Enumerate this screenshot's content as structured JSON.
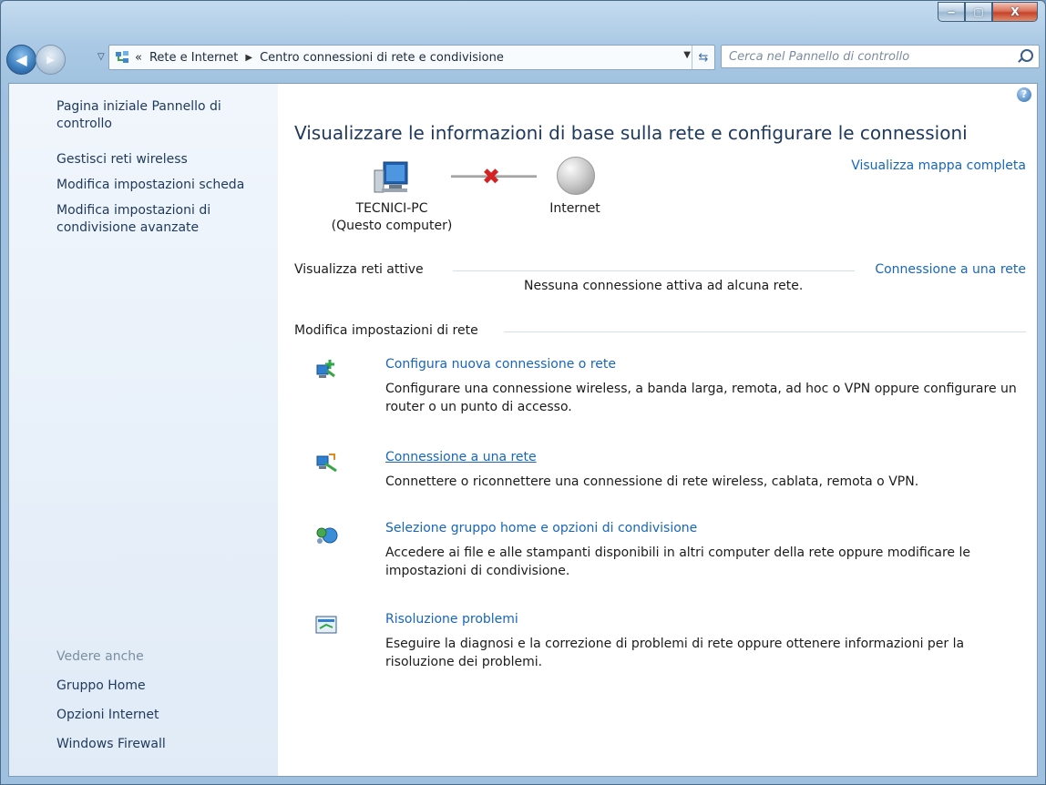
{
  "window": {
    "minimize_glyph": "‒",
    "maximize_glyph": "▢",
    "close_glyph": "X"
  },
  "address": {
    "back_glyph": "◀",
    "forward_glyph": "▶",
    "recent_glyph": "▽",
    "overflow": "«",
    "segments": [
      "Rete e Internet",
      "Centro connessioni di rete e condivisione"
    ],
    "separator": "▶",
    "dropdown_glyph": "▼",
    "refresh_glyph": "⇆",
    "search_placeholder": "Cerca nel Pannello di controllo"
  },
  "sidebar": {
    "home_link": "Pagina iniziale Pannello di controllo",
    "links": [
      "Gestisci reti wireless",
      "Modifica impostazioni scheda",
      "Modifica impostazioni di condivisione avanzate"
    ],
    "see_also_heading": "Vedere anche",
    "see_also": [
      "Gruppo Home",
      "Opzioni Internet",
      "Windows Firewall"
    ]
  },
  "main": {
    "help_glyph": "?",
    "title": "Visualizzare le informazioni di base sulla rete e configurare le connessioni",
    "map_link": "Visualizza mappa completa",
    "computer_name": "TECNICI-PC",
    "computer_sub": "(Questo computer)",
    "internet_label": "Internet",
    "disconnected_glyph": "✖",
    "active_networks_heading": "Visualizza reti attive",
    "connect_link": "Connessione a una rete",
    "no_connection_text": "Nessuna connessione attiva ad alcuna rete.",
    "change_settings_heading": "Modifica impostazioni di rete",
    "tasks": [
      {
        "link": "Configura nuova connessione o rete",
        "desc": "Configurare una connessione wireless, a banda larga, remota, ad hoc o VPN oppure configurare un router o un punto di accesso."
      },
      {
        "link": "Connessione a una rete",
        "desc": "Connettere o riconnettere una connessione di rete wireless, cablata, remota o VPN."
      },
      {
        "link": "Selezione gruppo home e opzioni di condivisione",
        "desc": "Accedere ai file e alle stampanti disponibili in altri computer della rete oppure modificare le impostazioni di condivisione."
      },
      {
        "link": "Risoluzione problemi",
        "desc": "Eseguire la diagnosi e la correzione di problemi di rete oppure ottenere informazioni per la risoluzione dei problemi."
      }
    ]
  },
  "colors": {
    "link": "#1866b9",
    "title": "#1e395b",
    "sidebar_bg": "#e6eff9"
  }
}
